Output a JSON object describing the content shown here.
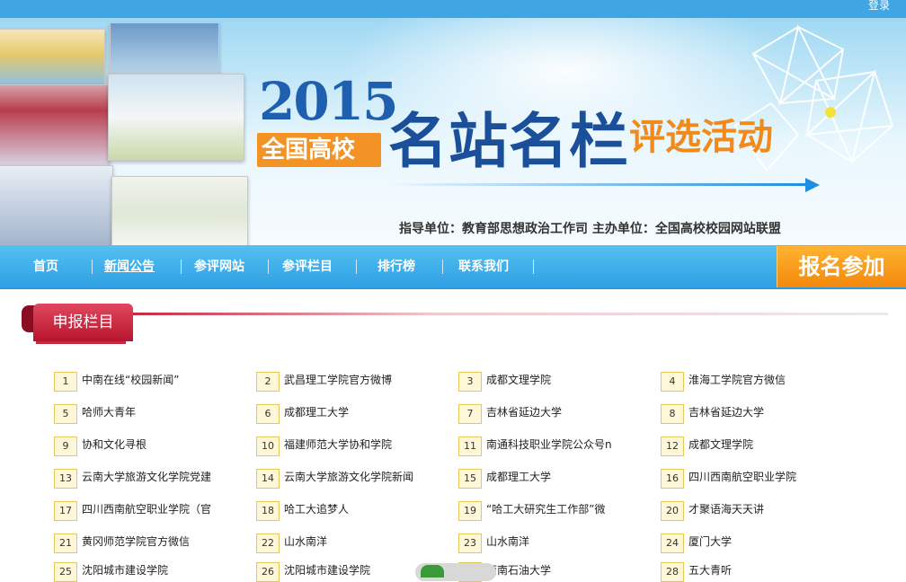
{
  "top": {
    "login": "登录"
  },
  "banner": {
    "year": "2015",
    "tag": "全国高校",
    "title": "名站名栏",
    "subtitle": "评选活动",
    "sponsor": "指导单位：教育部思想政治工作司    主办单位：全国高校校园网站联盟"
  },
  "nav": {
    "items": [
      "首页",
      "新闻公告",
      "参评网站",
      "参评栏目",
      "排行榜",
      "联系我们"
    ],
    "signup": "报名参加"
  },
  "section": {
    "title": "申报栏目"
  },
  "entries": [
    {
      "n": "1",
      "t": "中南在线“校园新闻”"
    },
    {
      "n": "2",
      "t": "武昌理工学院官方微博"
    },
    {
      "n": "3",
      "t": "成都文理学院"
    },
    {
      "n": "4",
      "t": "淮海工学院官方微信"
    },
    {
      "n": "5",
      "t": "哈师大青年"
    },
    {
      "n": "6",
      "t": "成都理工大学"
    },
    {
      "n": "7",
      "t": "吉林省延边大学"
    },
    {
      "n": "8",
      "t": "吉林省延边大学"
    },
    {
      "n": "9",
      "t": "协和文化寻根"
    },
    {
      "n": "10",
      "t": "福建师范大学协和学院"
    },
    {
      "n": "11",
      "t": "南通科技职业学院公众号n"
    },
    {
      "n": "12",
      "t": "成都文理学院"
    },
    {
      "n": "13",
      "t": "云南大学旅游文化学院党建"
    },
    {
      "n": "14",
      "t": "云南大学旅游文化学院新闻"
    },
    {
      "n": "15",
      "t": "成都理工大学"
    },
    {
      "n": "16",
      "t": "四川西南航空职业学院"
    },
    {
      "n": "17",
      "t": "四川西南航空职业学院（官"
    },
    {
      "n": "18",
      "t": "哈工大追梦人"
    },
    {
      "n": "19",
      "t": "“哈工大研究生工作部”微"
    },
    {
      "n": "20",
      "t": "才聚语海天天讲"
    },
    {
      "n": "21",
      "t": "黄冈师范学院官方微信"
    },
    {
      "n": "22",
      "t": "山水南洋"
    },
    {
      "n": "23",
      "t": "山水南洋"
    },
    {
      "n": "24",
      "t": "厦门大学"
    },
    {
      "n": "25",
      "t": "沈阳城市建设学院"
    },
    {
      "n": "26",
      "t": "沈阳城市建设学院"
    },
    {
      "n": "27",
      "t": "西南石油大学"
    },
    {
      "n": "28",
      "t": "五大青听"
    }
  ]
}
